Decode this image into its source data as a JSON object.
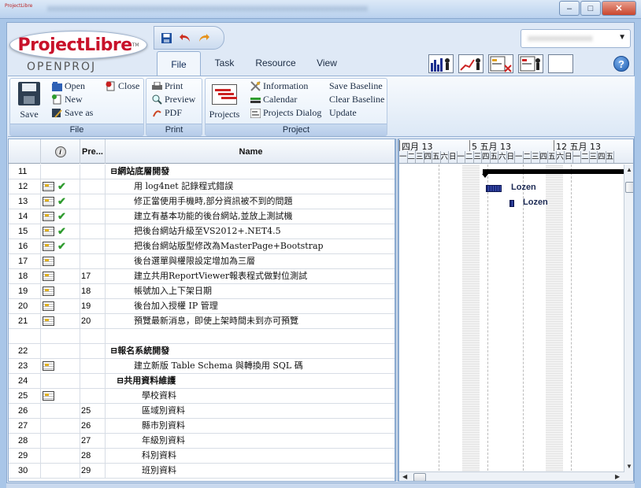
{
  "window": {
    "mini_logo": "ProjectLibre",
    "title_blurred": "xxxxxxxxxxxxxxxxxxxxxxxxxxxxxxxxxxxxxxxxxxxxxxxxxxxxxxxxxxxxxxxxxxxxxxxxxx",
    "minimize": "–",
    "maximize": "□",
    "close": "✕"
  },
  "logo": {
    "main": "ProjectLibre",
    "tm": "TM",
    "sub": "OPENPROJ"
  },
  "project_selector": {
    "value_blurred": "xxxxxxxxxxxxxxx",
    "caret": "▼"
  },
  "tabs": [
    "File",
    "Task",
    "Resource",
    "View"
  ],
  "active_tab": "File",
  "help_label": "?",
  "ribbon": {
    "file_group": {
      "label": "File",
      "save": "Save",
      "open": "Open",
      "new": "New",
      "save_as": "Save as",
      "close": "Close"
    },
    "print_group": {
      "label": "Print",
      "print": "Print",
      "preview": "Preview",
      "pdf": "PDF"
    },
    "project_group": {
      "label": "Project",
      "projects": "Projects",
      "information": "Information",
      "calendar": "Calendar",
      "projects_dialog": "Projects Dialog",
      "save_baseline": "Save Baseline",
      "clear_baseline": "Clear Baseline",
      "update": "Update"
    }
  },
  "table": {
    "headers": {
      "indicators_icon": "i",
      "predecessors": "Pre...",
      "name": "Name"
    },
    "rows": [
      {
        "id": "11",
        "note": false,
        "done": false,
        "pre": "",
        "name": "⊟網站底層開發"
      },
      {
        "id": "12",
        "note": true,
        "done": true,
        "pre": "",
        "name": "用 log4net 記錄程式錯誤"
      },
      {
        "id": "13",
        "note": true,
        "done": true,
        "pre": "",
        "name": "修正當使用手機時,部分資訊被不到的問題"
      },
      {
        "id": "14",
        "note": true,
        "done": true,
        "pre": "",
        "name": "建立有基本功能的後台網站,並放上測試機"
      },
      {
        "id": "15",
        "note": true,
        "done": true,
        "pre": "",
        "name": "把後台網站升級至VS2012+.NET4.5"
      },
      {
        "id": "16",
        "note": true,
        "done": true,
        "pre": "",
        "name": "把後台網站版型修改為MasterPage+Bootstrap"
      },
      {
        "id": "17",
        "note": true,
        "done": false,
        "pre": "",
        "name": "後台選單與權限設定增加為三層"
      },
      {
        "id": "18",
        "note": true,
        "done": false,
        "pre": "17",
        "name": "建立共用ReportViewer報表程式做對位測試"
      },
      {
        "id": "19",
        "note": true,
        "done": false,
        "pre": "18",
        "name": "帳號加入上下架日期"
      },
      {
        "id": "20",
        "note": true,
        "done": false,
        "pre": "19",
        "name": "後台加入授權 IP 管理"
      },
      {
        "id": "21",
        "note": true,
        "done": false,
        "pre": "20",
        "name": "預覽最新消息，即使上架時間未到亦可預覽"
      },
      {
        "id": "",
        "note": false,
        "done": false,
        "pre": "",
        "name": ""
      },
      {
        "id": "22",
        "note": false,
        "done": false,
        "pre": "",
        "name": "⊟報名系統開發"
      },
      {
        "id": "23",
        "note": true,
        "done": false,
        "pre": "",
        "name": "建立新版 Table Schema 與轉換用 SQL 碼"
      },
      {
        "id": "24",
        "note": false,
        "done": false,
        "pre": "",
        "name": "⊟共用資料維護"
      },
      {
        "id": "25",
        "note": true,
        "done": false,
        "pre": "",
        "name": "學校資料"
      },
      {
        "id": "26",
        "note": false,
        "done": false,
        "pre": "25",
        "name": "區域別資料"
      },
      {
        "id": "27",
        "note": false,
        "done": false,
        "pre": "26",
        "name": "縣市別資料"
      },
      {
        "id": "28",
        "note": false,
        "done": false,
        "pre": "27",
        "name": "年級別資料"
      },
      {
        "id": "29",
        "note": false,
        "done": false,
        "pre": "28",
        "name": "科別資料"
      },
      {
        "id": "30",
        "note": false,
        "done": false,
        "pre": "29",
        "name": "班別資料"
      }
    ]
  },
  "gantt": {
    "weeks": [
      "四月 13",
      "5 五月 13",
      "12 五月 13"
    ],
    "days": [
      "一",
      "二",
      "三",
      "四",
      "五",
      "六",
      "日",
      "一",
      "二",
      "三",
      "四",
      "五",
      "六",
      "日",
      "一",
      "二",
      "三",
      "四",
      "五",
      "六",
      "日",
      "一",
      "二",
      "三",
      "四",
      "五"
    ],
    "resource_labels": [
      "Lozen",
      "Lozen"
    ]
  }
}
